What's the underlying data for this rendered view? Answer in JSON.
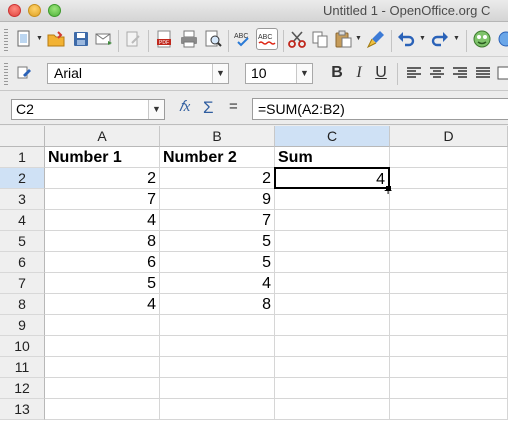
{
  "window": {
    "title": "Untitled 1 - OpenOffice.org C"
  },
  "toolbar": {
    "font_name": "Arial",
    "font_size": "10",
    "bold_label": "B",
    "italic_label": "I",
    "underline_label": "U"
  },
  "formula_bar": {
    "cell_reference": "C2",
    "equals_label": "=",
    "formula": "=SUM(A2:B2)"
  },
  "sheet": {
    "columns": [
      "A",
      "B",
      "C",
      "D"
    ],
    "rows": [
      "1",
      "2",
      "3",
      "4",
      "5",
      "6",
      "7",
      "8",
      "9",
      "10",
      "11",
      "12",
      "13"
    ],
    "selected_cell": "C2",
    "headers": {
      "A1": "Number 1",
      "B1": "Number 2",
      "C1": "Sum"
    },
    "values": [
      {
        "row": "2",
        "a": "2",
        "b": "2",
        "c": "4"
      },
      {
        "row": "3",
        "a": "7",
        "b": "9",
        "c": ""
      },
      {
        "row": "4",
        "a": "4",
        "b": "7",
        "c": ""
      },
      {
        "row": "5",
        "a": "8",
        "b": "5",
        "c": ""
      },
      {
        "row": "6",
        "a": "6",
        "b": "5",
        "c": ""
      },
      {
        "row": "7",
        "a": "5",
        "b": "4",
        "c": ""
      },
      {
        "row": "8",
        "a": "4",
        "b": "8",
        "c": ""
      }
    ]
  }
}
